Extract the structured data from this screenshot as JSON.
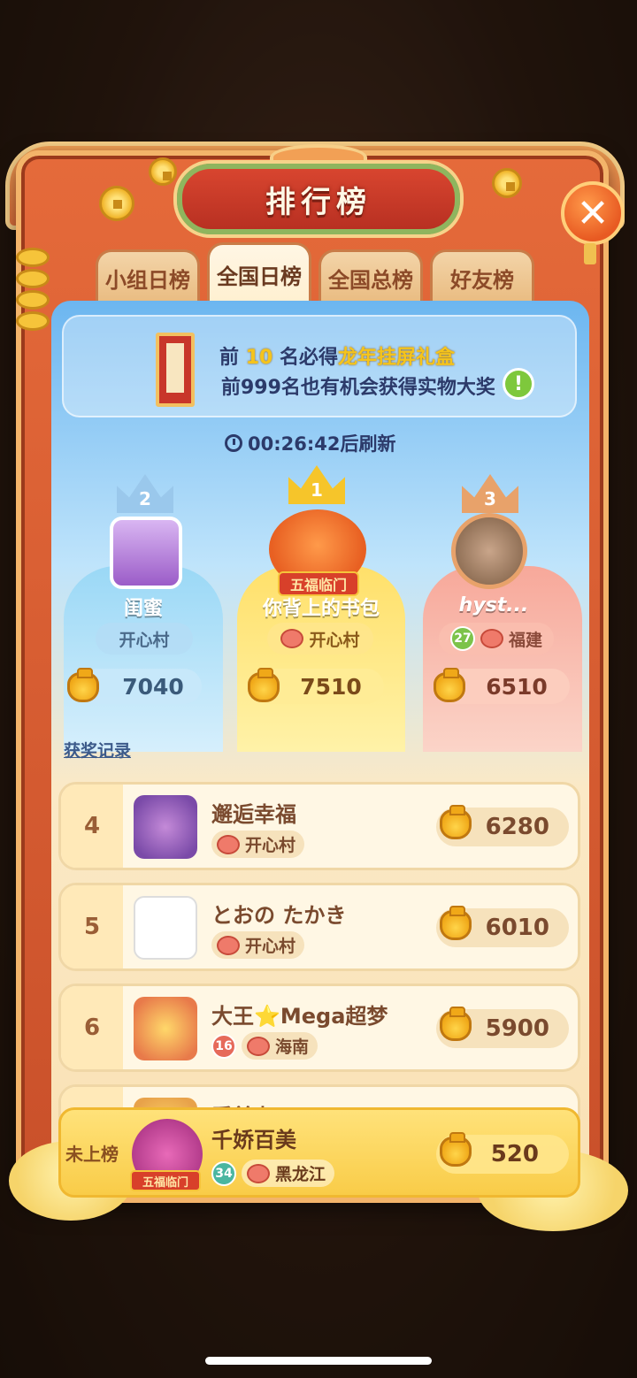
{
  "title": "排行榜",
  "close_icon": "close-icon",
  "tabs": [
    {
      "label": "小组日榜",
      "active": false
    },
    {
      "label": "全国日榜",
      "active": true
    },
    {
      "label": "全国总榜",
      "active": false
    },
    {
      "label": "好友榜",
      "active": false
    }
  ],
  "banner": {
    "prefix": "前",
    "highlight_num": "10",
    "mid": "名必得",
    "highlight_prize": "龙年挂屏礼盒",
    "line2": "前999名也有机会获得实物大奖",
    "info_icon": "!"
  },
  "timer": {
    "text": "00:26:42后刷新"
  },
  "podium": {
    "first": {
      "rank": "1",
      "name": "你背上的书包",
      "region": "开心村",
      "score": "7510",
      "avatar_banner": "五福临门"
    },
    "second": {
      "rank": "2",
      "name": "闺蜜",
      "region": "开心村",
      "score": "7040"
    },
    "third": {
      "rank": "3",
      "name": "hyst...",
      "region": "福建",
      "level": "27",
      "score": "6510"
    }
  },
  "award_link": "获奖记录",
  "rows": [
    {
      "rank": "4",
      "name": "邂逅幸福",
      "region": "开心村",
      "score": "6280"
    },
    {
      "rank": "5",
      "name": "とおの たかき",
      "region": "开心村",
      "score": "6010"
    },
    {
      "rank": "6",
      "name": "大王⭐Mega超梦",
      "region": "海南",
      "level": "16",
      "score": "5900"
    },
    {
      "rank": "",
      "name": "看美丸",
      "region": "",
      "score": ""
    }
  ],
  "me": {
    "rank": "未上榜",
    "name": "千娇百美",
    "level": "34",
    "region": "黑龙江",
    "score": "520",
    "avatar_banner": "五福临门"
  },
  "colors": {
    "frame": "#e56a3a",
    "gold": "#f9cc48",
    "panel_top": "#6cb6f0"
  }
}
